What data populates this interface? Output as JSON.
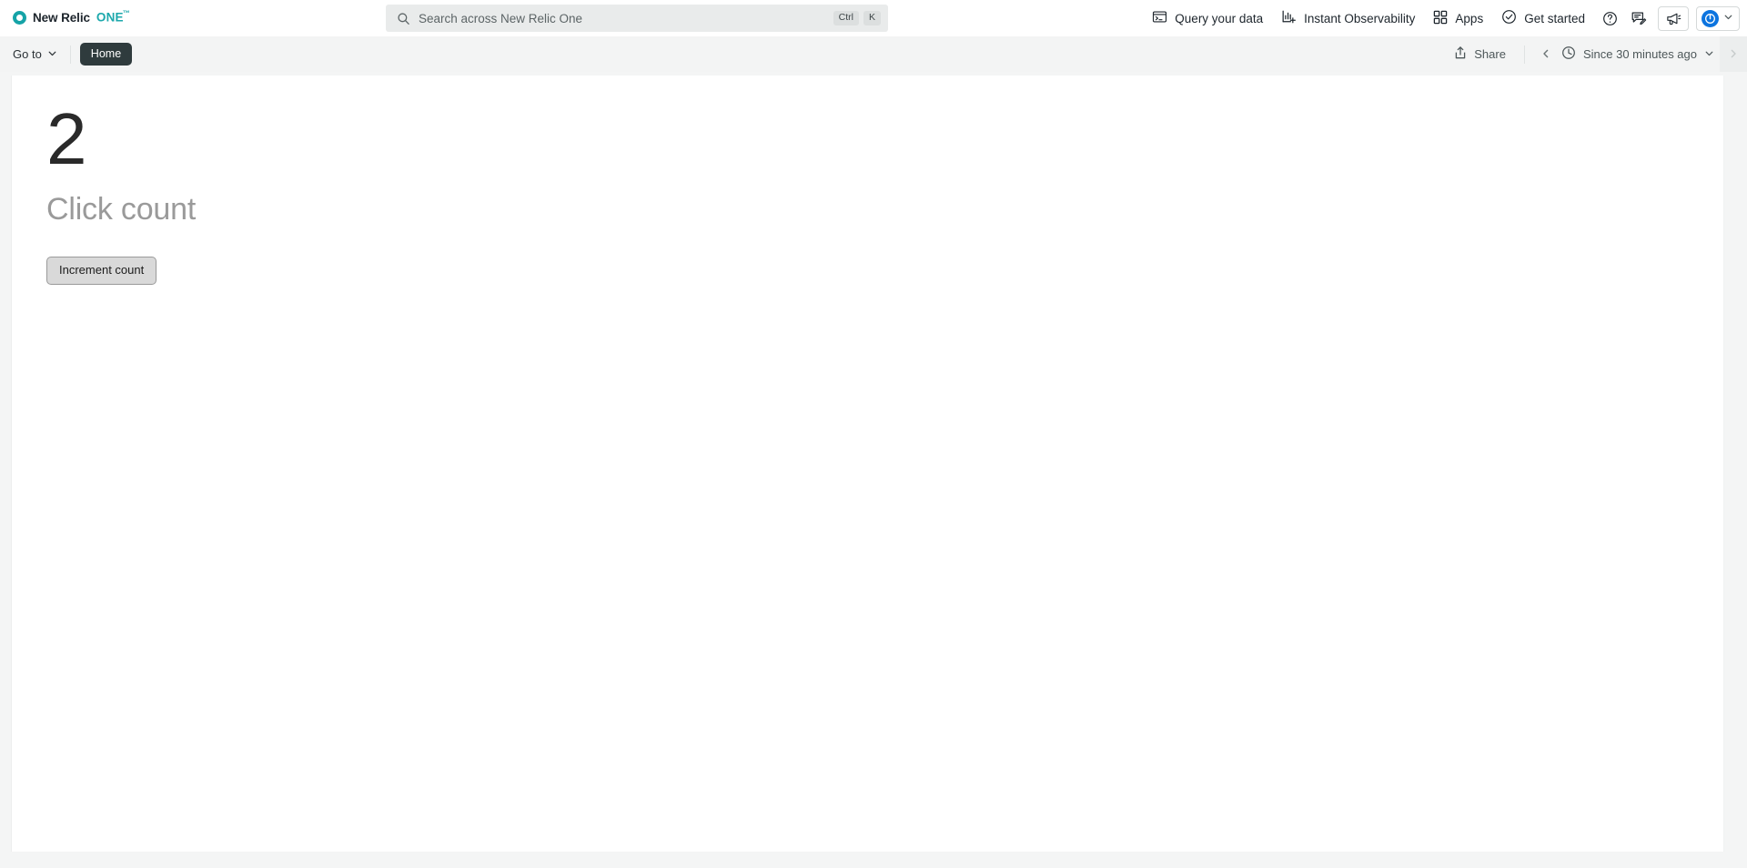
{
  "brand": {
    "mark_icon": "new-relic-circle-icon",
    "name": "New Relic",
    "product": "ONE",
    "trademark": "™",
    "accent_color": "#1CA8AC"
  },
  "search": {
    "icon": "search-icon",
    "placeholder": "Search across New Relic One",
    "value": "",
    "shortcut_keys": [
      "Ctrl",
      "K"
    ]
  },
  "topnav": {
    "items": [
      {
        "label": "Query your data",
        "icon": "terminal-icon"
      },
      {
        "label": "Instant Observability",
        "icon": "bar-chart-plus-icon"
      },
      {
        "label": "Apps",
        "icon": "grid-apps-icon"
      },
      {
        "label": "Get started",
        "icon": "check-circle-icon"
      }
    ],
    "icon_buttons": [
      {
        "name": "help-icon",
        "label": "?"
      },
      {
        "name": "feedback-edit-icon",
        "label": ""
      },
      {
        "name": "megaphone-icon",
        "label": ""
      }
    ],
    "user": {
      "avatar_icon": "user-power-avatar-icon",
      "avatar_color": "#0c74df",
      "chevron_icon": "chevron-down-icon"
    }
  },
  "subbar": {
    "goto_label": "Go to",
    "goto_chevron": "chevron-down-icon",
    "home_label": "Home",
    "share_label": "Share",
    "share_icon": "share-upload-icon",
    "prev_icon": "chevron-left-icon",
    "next_icon": "chevron-right-icon",
    "time_icon": "clock-icon",
    "time_range": "Since 30 minutes ago",
    "time_chevron": "chevron-down-icon"
  },
  "app": {
    "count_value": "2",
    "count_label": "Click count",
    "increment_button_label": "Increment count"
  }
}
